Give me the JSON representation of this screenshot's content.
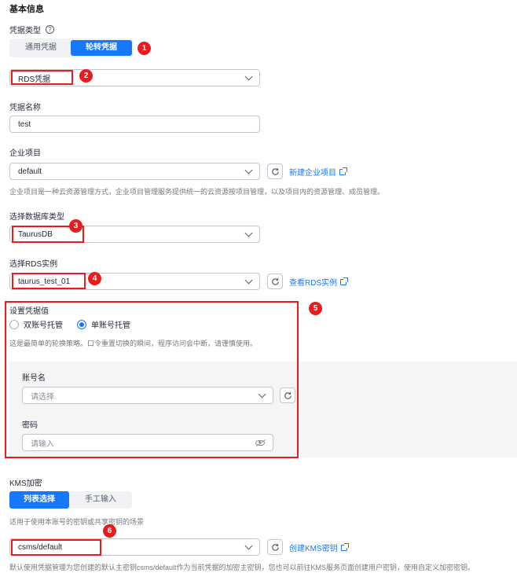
{
  "basic_info": {
    "title": "基本信息"
  },
  "credential_type": {
    "label": "凭据类型",
    "options": [
      "通用凭据",
      "轮转凭据"
    ],
    "selected": "轮转凭据",
    "badge": "1"
  },
  "rds_credential": {
    "value": "RDS凭据",
    "badge": "2"
  },
  "credential_name": {
    "label": "凭据名称",
    "value": "test"
  },
  "enterprise_project": {
    "label": "企业项目",
    "value": "default",
    "link": "新建企业项目",
    "hint": "企业项目是一种云资源管理方式，企业项目管理服务提供统一的云资源按项目管理，以及项目内的资源管理、成员管理。"
  },
  "db_type": {
    "label": "选择数据库类型",
    "value": "TaurusDB",
    "badge": "3"
  },
  "rds_instance": {
    "label": "选择RDS实例",
    "value": "taurus_test_01",
    "link": "查看RDS实例",
    "badge": "4"
  },
  "credential_value": {
    "label": "设置凭据值",
    "badge": "5",
    "options": [
      "双账号托管",
      "单账号托管"
    ],
    "selected": "单账号托管",
    "hint": "这是最简单的轮换策略。口令重置切换的瞬间，程序访问会中断，请谨慎使用。",
    "account": {
      "label": "账号名",
      "placeholder": "请选择"
    },
    "password": {
      "label": "密码",
      "placeholder": "请输入"
    }
  },
  "kms": {
    "label": "KMS加密",
    "tabs": [
      "列表选择",
      "手工输入"
    ],
    "selected_tab": "列表选择",
    "hint": "适用于使用本账号的密钥或共享密钥的场景",
    "value": "csms/default",
    "link": "创建KMS密钥",
    "badge": "6",
    "footer": "默认使用凭据管理为您创建的默认主密钥csms/default作为当前凭据的加密主密钥，您也可以前往KMS服务页面创建用户密钥，使用自定义加密密钥。"
  },
  "colors": {
    "accent": "#1677ff",
    "annotation": "#e81c1c"
  },
  "icons": [
    "help-icon",
    "chevron-down-icon",
    "refresh-icon",
    "external-link-icon",
    "eye-off-icon"
  ]
}
